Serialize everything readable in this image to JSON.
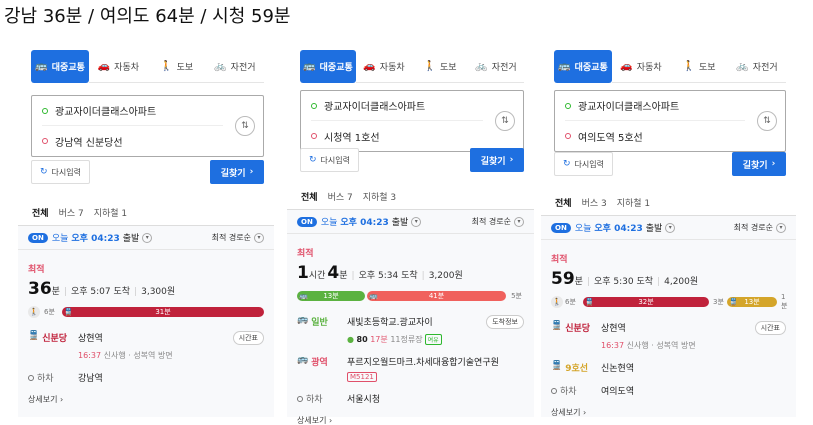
{
  "headline": "강남 36분 / 여의도 64분 / 시청 59분",
  "panels": [
    {
      "modes": [
        "대중교통",
        "자동차",
        "도보",
        "자전거"
      ],
      "origin": "광교자이더클래스아파트",
      "destination": "강남역 신분당선",
      "reset": "다시입력",
      "go": "길찾기",
      "tabs": [
        "전체",
        "버스 7",
        "지하철 1"
      ],
      "filter": {
        "badge": "ON",
        "today": "오늘",
        "time": "오후 04:23",
        "depart": "출발",
        "sort": "최적 경로순"
      },
      "best": "최적",
      "duration_num": "36",
      "duration_unit": "분",
      "arrive": "오후 5:07 도착",
      "fare": "3,300원",
      "bar": {
        "walk": "6분",
        "seg_label": "31분"
      },
      "steps": [
        {
          "line": "신분당",
          "station": "상현역",
          "time": "16:37",
          "detail": "신사행 · 성복역 방면",
          "pill": "시간표"
        }
      ],
      "stop_label": "하차",
      "stop_station": "강남역",
      "more": "상세보기"
    },
    {
      "modes": [
        "대중교통",
        "자동차",
        "도보",
        "자전거"
      ],
      "origin": "광교자이더클래스아파트",
      "destination": "시청역 1호선",
      "reset": "다시입력",
      "go": "길찾기",
      "tabs": [
        "전체",
        "버스 7",
        "지하철 3"
      ],
      "filter": {
        "badge": "ON",
        "today": "오늘",
        "time": "오후 04:23",
        "depart": "출발",
        "sort": "최적 경로순"
      },
      "best": "최적",
      "duration_h": "1",
      "duration_hunit": "시간",
      "duration_num": "4",
      "duration_unit": "분",
      "arrive": "오후 5:34 도착",
      "fare": "3,200원",
      "bar": {
        "seg1": "13분",
        "seg2": "41분",
        "end": "5분"
      },
      "steps": [
        {
          "line": "일반",
          "station": "새빛초등학교.광교자이",
          "bus": "80",
          "time": "17분",
          "detail": "11정류장",
          "tag": "여유",
          "pill": "도착정보"
        },
        {
          "line": "광역",
          "station": "푸르지오월드마크.차세대융합기술연구원",
          "bus": "M5121"
        }
      ],
      "stop_label": "하차",
      "stop_station": "서울시청",
      "more": "상세보기"
    },
    {
      "modes": [
        "대중교통",
        "자동차",
        "도보",
        "자전거"
      ],
      "origin": "광교자이더클래스아파트",
      "destination": "여의도역 5호선",
      "reset": "다시입력",
      "go": "길찾기",
      "tabs": [
        "전체",
        "버스 3",
        "지하철 1"
      ],
      "filter": {
        "badge": "ON",
        "today": "오늘",
        "time": "오후 04:23",
        "depart": "출발",
        "sort": "최적 경로순"
      },
      "best": "최적",
      "duration_num": "59",
      "duration_unit": "분",
      "arrive": "오후 5:30 도착",
      "fare": "4,200원",
      "bar": {
        "walk": "6분",
        "seg1": "32분",
        "mid": "3분",
        "seg2": "13분",
        "end": "1분"
      },
      "steps": [
        {
          "line": "신분당",
          "station": "상현역",
          "time": "16:37",
          "detail": "신사행 · 성복역 방면",
          "pill": "시간표"
        },
        {
          "line": "9호선",
          "station": "신논현역"
        }
      ],
      "stop_label": "하차",
      "stop_station": "여의도역",
      "more": "상세보기"
    }
  ],
  "colors": {
    "accent": "#1e6fe0",
    "shinbundang": "#c0223b",
    "line9": "#d4a52a",
    "bus_express": "#e0506a",
    "bus_general": "#5bb240"
  }
}
